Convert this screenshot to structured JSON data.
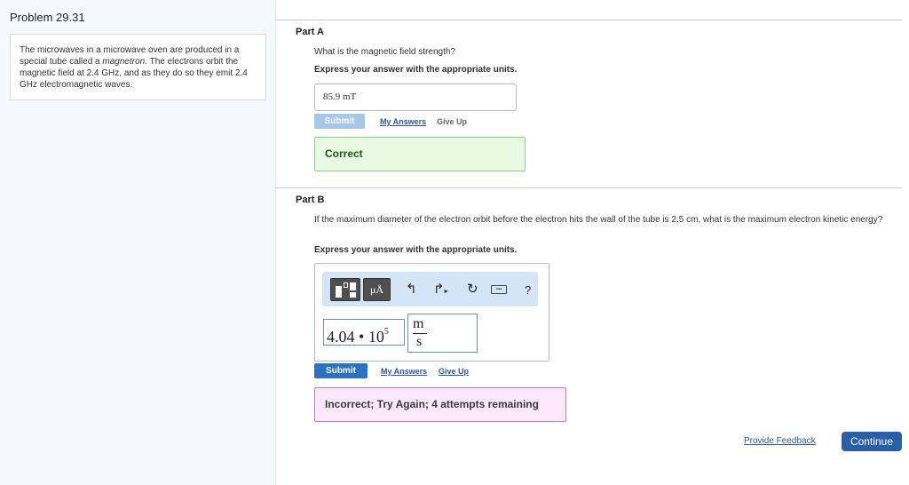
{
  "problem": {
    "title": "Problem 29.31",
    "text_before": "The microwaves in a microwave oven are produced in a special tube called a ",
    "text_em": "magnetron",
    "text_after": ". The electrons orbit the magnetic field at 2.4 GHz, and as they do so they emit 2.4 GHz electromagnetic waves."
  },
  "part_a": {
    "title": "Part A",
    "question": "What is the magnetic field strength?",
    "instruction": "Express your answer with the appropriate units.",
    "answer": "85.9 mT",
    "submit_label": "Submit",
    "my_answers_label": "My Answers",
    "give_up_label": "Give Up",
    "feedback": "Correct"
  },
  "part_b": {
    "title": "Part B",
    "question": "If the maximum diameter of the electron orbit before the electron hits the wall of the tube is 2.5 cm, what is the maximum electron kinetic energy?",
    "instruction": "Express your answer with the appropriate units.",
    "toolbar": {
      "units_label": "μÅ",
      "help_label": "?",
      "icons": [
        "templates-icon",
        "units-icon",
        "undo-icon",
        "redo-icon",
        "reset-icon",
        "keyboard-icon",
        "help-icon"
      ]
    },
    "value_mantissa": "4.04",
    "value_times": "•",
    "value_base": "10",
    "value_exponent": "5",
    "unit_numerator": "m",
    "unit_denominator": "s",
    "submit_label": "Submit",
    "my_answers_label": "My Answers",
    "give_up_label": "Give Up",
    "feedback": "Incorrect; Try Again; 4 attempts remaining"
  },
  "footer": {
    "feedback_link": "Provide Feedback",
    "continue_label": "Continue"
  },
  "colors": {
    "primary_button": "#2a73c2",
    "disabled_button": "#a6c8e8",
    "correct_bg": "#e8fbe2",
    "incorrect_bg": "#fde9fb"
  }
}
